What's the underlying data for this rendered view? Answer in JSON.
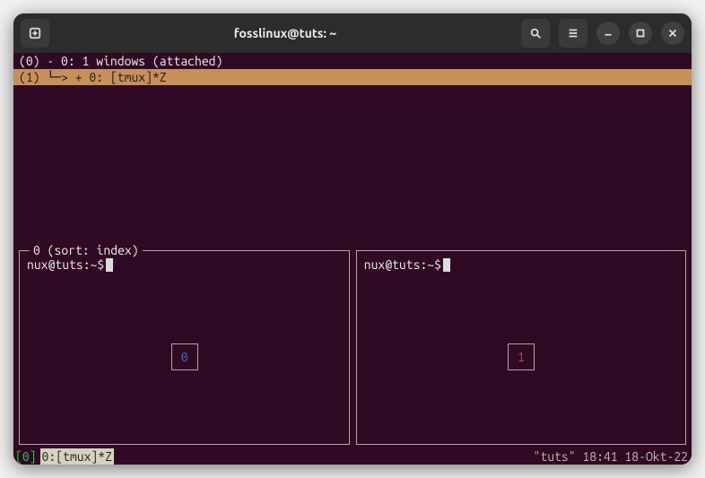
{
  "window": {
    "title": "fosslinux@tuts: ~"
  },
  "tree": {
    "session_line": "(0) - 0: 1 windows (attached)",
    "window_line": "(1) └─> + 0: [tmux]*Z"
  },
  "preview": {
    "header": "0 (sort: index)",
    "panes": [
      {
        "prompt": "nux@tuts:~$",
        "number": "0"
      },
      {
        "prompt": "nux@tuts:~$",
        "number": "1"
      }
    ]
  },
  "statusbar": {
    "session": "[0]",
    "window": "0:[tmux]*Z",
    "right": "\"tuts\" 18:41 18-Okt-22"
  }
}
